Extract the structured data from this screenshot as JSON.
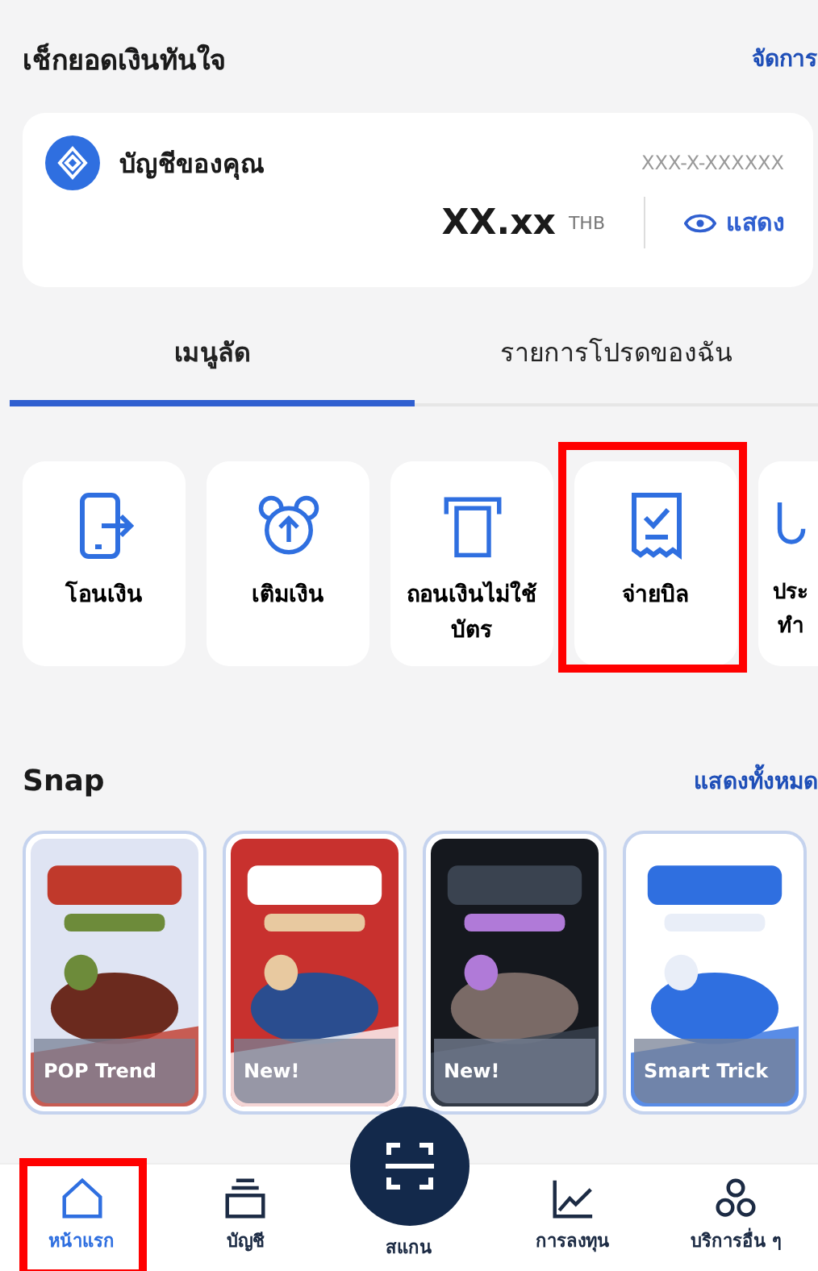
{
  "balance_section": {
    "title": "เช็กยอดเงินทันใจ",
    "action": "จัดการ"
  },
  "account": {
    "name": "บัญชีของคุณ",
    "number": "XXX-X-XXXXXX",
    "balance": "XX.xx",
    "currency": "THB",
    "show_label": "แสดง"
  },
  "tabs": [
    {
      "label": "เมนูลัด",
      "selected": true
    },
    {
      "label": "รายการโปรดของฉัน",
      "selected": false
    }
  ],
  "shortcuts": [
    {
      "kind": "transfer",
      "label": "โอนเงิน",
      "highlighted": false
    },
    {
      "kind": "topup",
      "label": "เติมเงิน",
      "highlighted": false
    },
    {
      "kind": "withdraw",
      "label": "ถอนเงินไม่ใช้บัตร",
      "highlighted": false
    },
    {
      "kind": "bill",
      "label": "จ่ายบิล",
      "highlighted": true
    },
    {
      "kind": "partial",
      "label": "ประ ทำ",
      "highlighted": false
    }
  ],
  "snap": {
    "title": "Snap",
    "action": "แสดงทั้งหมด",
    "items": [
      {
        "caption": "POP Trend"
      },
      {
        "caption": "New!"
      },
      {
        "caption": "New!"
      },
      {
        "caption": "Smart Trick"
      }
    ]
  },
  "bottom_nav": [
    {
      "kind": "home",
      "label": "หน้าแรก",
      "selected": true,
      "highlighted": true
    },
    {
      "kind": "account",
      "label": "บัญชี",
      "selected": false,
      "highlighted": false
    },
    {
      "kind": "scan",
      "label": "สแกน",
      "selected": false,
      "highlighted": false
    },
    {
      "kind": "invest",
      "label": "การลงทุน",
      "selected": false,
      "highlighted": false
    },
    {
      "kind": "more",
      "label": "บริการอื่น ๆ",
      "selected": false,
      "highlighted": false
    }
  ]
}
